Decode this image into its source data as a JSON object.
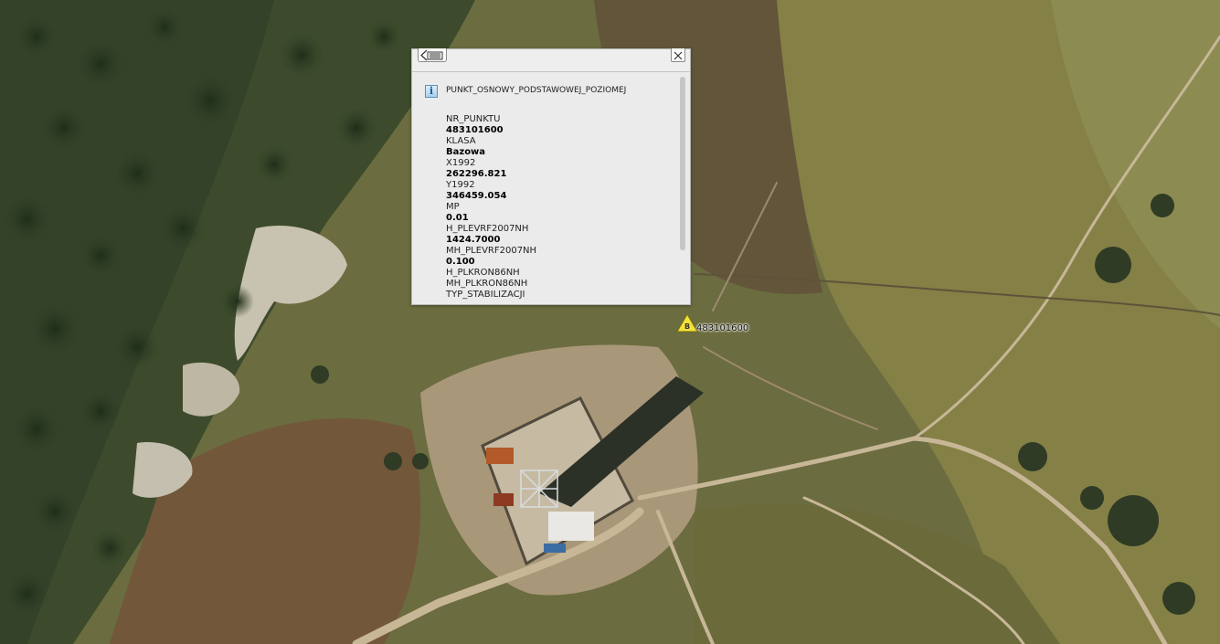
{
  "popup": {
    "layer_name": "PUNKT_OSNOWY_PODSTAWOWEJ_POZIOMEJ",
    "icons": {
      "info": "info-icon",
      "back": "back-list-icon",
      "close": "close-icon"
    },
    "info_glyph": "i",
    "attributes": [
      {
        "label": "NR_PUNKTU",
        "value": "483101600"
      },
      {
        "label": "KLASA",
        "value": "Bazowa"
      },
      {
        "label": "X1992",
        "value": "262296.821"
      },
      {
        "label": "Y1992",
        "value": "346459.054"
      },
      {
        "label": "MP",
        "value": "0.01"
      },
      {
        "label": "H_PLEVRF2007NH",
        "value": "1424.7000"
      },
      {
        "label": "MH_PLEVRF2007NH",
        "value": "0.100"
      },
      {
        "label": "H_PLKRON86NH",
        "value": ""
      },
      {
        "label": "MH_PLKRON86NH",
        "value": ""
      },
      {
        "label": "TYP_STABILIZACJI",
        "value": ""
      }
    ]
  },
  "marker": {
    "label": "483101600",
    "glyph": "B",
    "icon": "survey-point-triangle-icon",
    "color": "#f3e23a"
  },
  "map": {
    "type": "satellite-orthophoto",
    "colors": {
      "forest": "#3b4a2a",
      "meadow": "#76733f",
      "path": "#c9b89a",
      "rock": "#cdc8b8"
    }
  }
}
